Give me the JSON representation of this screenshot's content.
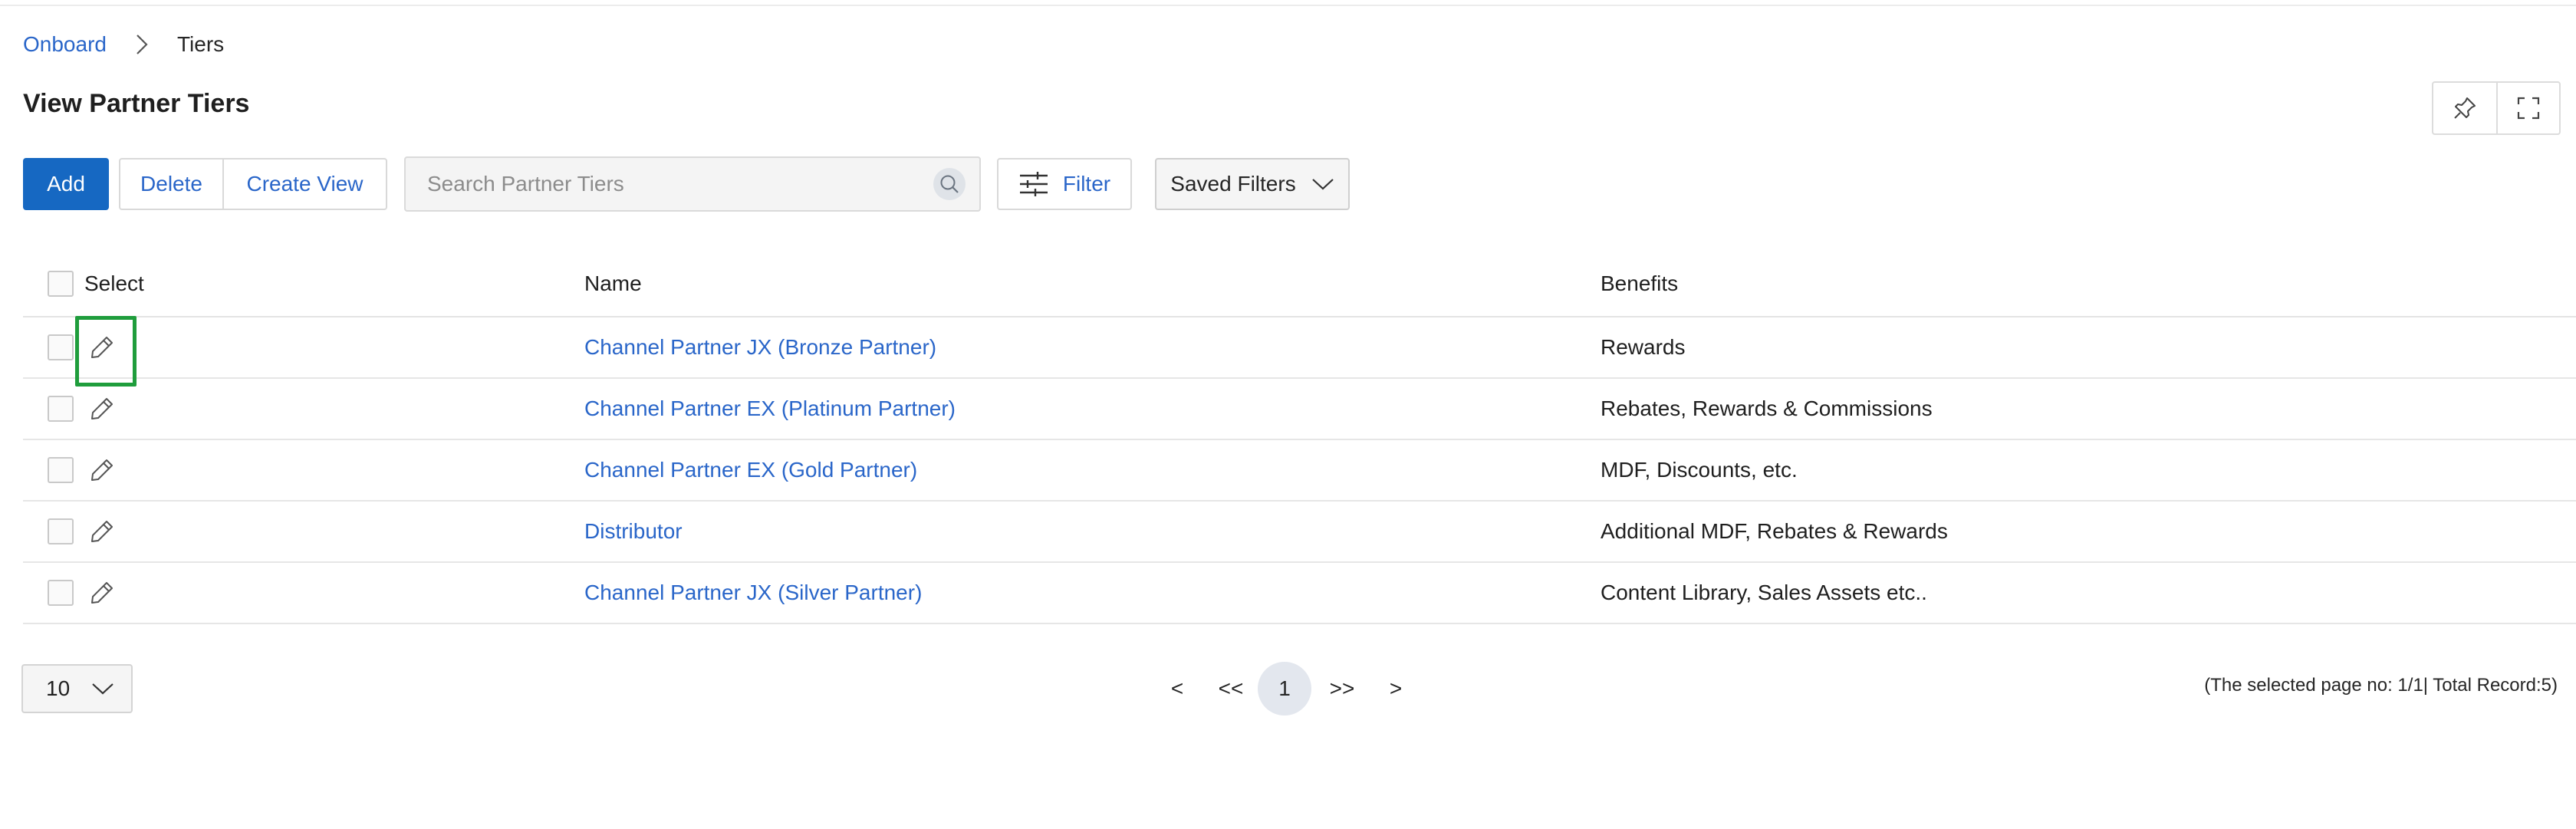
{
  "breadcrumb": {
    "root": "Onboard",
    "current": "Tiers"
  },
  "page": {
    "title": "View Partner Tiers"
  },
  "toolbar": {
    "add_label": "Add",
    "delete_label": "Delete",
    "create_view_label": "Create View",
    "search_placeholder": "Search Partner Tiers",
    "filter_label": "Filter",
    "saved_filters_label": "Saved Filters"
  },
  "table": {
    "columns": {
      "select": "Select",
      "name": "Name",
      "benefits": "Benefits"
    },
    "rows": [
      {
        "name": "Channel Partner JX (Bronze Partner)",
        "benefits": "Rewards"
      },
      {
        "name": "Channel Partner EX (Platinum Partner)",
        "benefits": "Rebates, Rewards & Commissions"
      },
      {
        "name": "Channel Partner EX (Gold Partner)",
        "benefits": "MDF, Discounts, etc."
      },
      {
        "name": "Distributor",
        "benefits": "Additional MDF, Rebates & Rewards"
      },
      {
        "name": "Channel Partner JX (Silver Partner)",
        "benefits": "Content Library, Sales Assets etc.."
      }
    ]
  },
  "pagination": {
    "page_size": "10",
    "prev": "<",
    "first": "<<",
    "current": "1",
    "last": ">>",
    "next": ">",
    "info": "(The selected page no: 1/1| Total Record:5)"
  },
  "colors": {
    "accent": "#1668c2",
    "link": "#2a66c9",
    "highlight": "#1f9d3c"
  },
  "icons": {
    "breadcrumb_sep": "chevron-right-icon",
    "pin": "pin-icon",
    "fullscreen": "fullscreen-icon",
    "search": "search-icon",
    "filter": "sliders-icon",
    "dropdown": "chevron-down-icon",
    "edit": "pencil-icon"
  }
}
